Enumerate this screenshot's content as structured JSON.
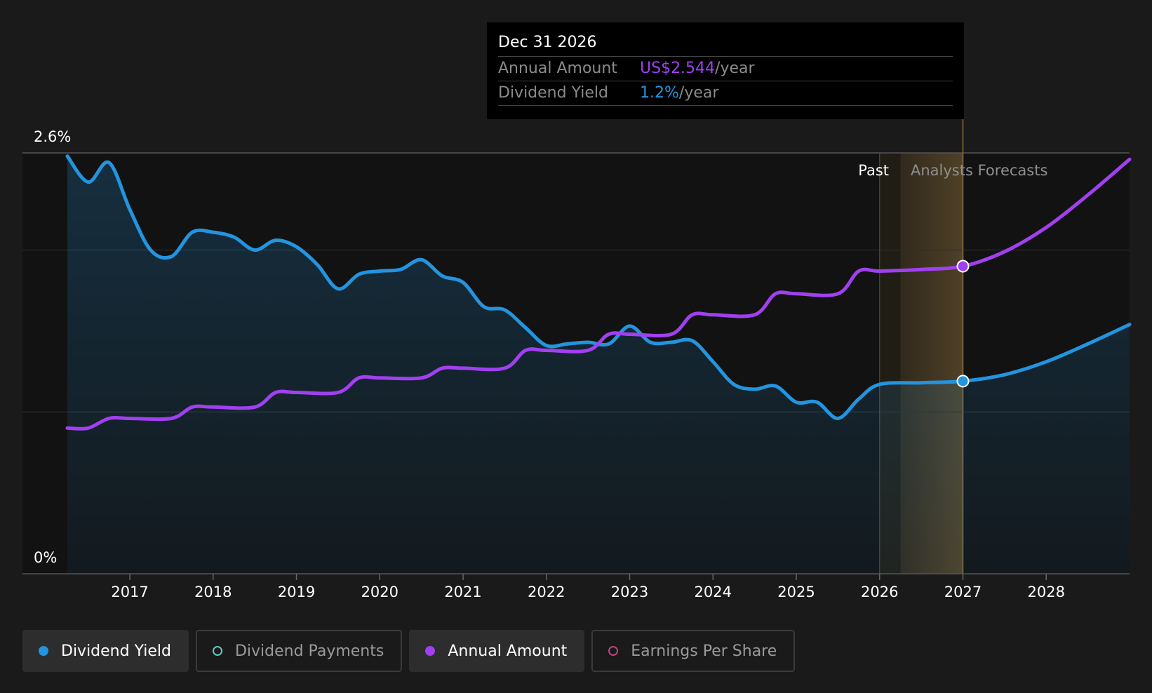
{
  "colors": {
    "yield": "#2394df",
    "annual": "#a040f0",
    "payments": "#5fc9bf",
    "eps": "#b9457e",
    "forecast_band": "#5a4a2a"
  },
  "tooltip": {
    "date": "Dec 31 2026",
    "rows": [
      {
        "label": "Annual Amount",
        "value": "US$2.544",
        "unit": "/year",
        "color": "#a040f0"
      },
      {
        "label": "Dividend Yield",
        "value": "1.2%",
        "unit": "/year",
        "color": "#2394df"
      }
    ]
  },
  "labels": {
    "past": "Past",
    "forecast": "Analysts Forecasts"
  },
  "legend": [
    {
      "label": "Dividend Yield",
      "active": true,
      "color": "#2394df",
      "icon": "filled-circle-icon"
    },
    {
      "label": "Dividend Payments",
      "active": false,
      "color": "#5fc9bf",
      "icon": "hollow-circle-icon"
    },
    {
      "label": "Annual Amount",
      "active": true,
      "color": "#a040f0",
      "icon": "filled-circle-icon"
    },
    {
      "label": "Earnings Per Share",
      "active": false,
      "color": "#b9457e",
      "icon": "hollow-circle-icon"
    }
  ],
  "chart_data": {
    "type": "line",
    "y_tick_labels": [
      "0%",
      "2.6%"
    ],
    "ylim": [
      0,
      2.6
    ],
    "xlim": [
      2016.25,
      2029.0
    ],
    "x_ticks": [
      "2017",
      "2018",
      "2019",
      "2020",
      "2021",
      "2022",
      "2023",
      "2024",
      "2025",
      "2026",
      "2027",
      "2028"
    ],
    "past_until": 2026.0,
    "forecast_start": 2026.25,
    "highlight_x": 2027.0,
    "legend_position": "bottom",
    "series": [
      {
        "name": "Dividend Yield",
        "area": true,
        "points": [
          [
            2016.25,
            2.58
          ],
          [
            2016.5,
            2.42
          ],
          [
            2016.75,
            2.54
          ],
          [
            2017.0,
            2.25
          ],
          [
            2017.25,
            2.0
          ],
          [
            2017.5,
            1.96
          ],
          [
            2017.75,
            2.11
          ],
          [
            2018.0,
            2.11
          ],
          [
            2018.25,
            2.08
          ],
          [
            2018.5,
            2.0
          ],
          [
            2018.75,
            2.06
          ],
          [
            2019.0,
            2.02
          ],
          [
            2019.25,
            1.91
          ],
          [
            2019.5,
            1.76
          ],
          [
            2019.75,
            1.85
          ],
          [
            2020.0,
            1.87
          ],
          [
            2020.25,
            1.88
          ],
          [
            2020.5,
            1.94
          ],
          [
            2020.75,
            1.84
          ],
          [
            2021.0,
            1.8
          ],
          [
            2021.25,
            1.65
          ],
          [
            2021.5,
            1.63
          ],
          [
            2021.75,
            1.52
          ],
          [
            2022.0,
            1.41
          ],
          [
            2022.25,
            1.42
          ],
          [
            2022.5,
            1.43
          ],
          [
            2022.75,
            1.42
          ],
          [
            2023.0,
            1.53
          ],
          [
            2023.25,
            1.43
          ],
          [
            2023.5,
            1.43
          ],
          [
            2023.75,
            1.44
          ],
          [
            2024.0,
            1.31
          ],
          [
            2024.25,
            1.17
          ],
          [
            2024.5,
            1.14
          ],
          [
            2024.75,
            1.16
          ],
          [
            2025.0,
            1.06
          ],
          [
            2025.25,
            1.06
          ],
          [
            2025.5,
            0.96
          ],
          [
            2025.75,
            1.08
          ],
          [
            2026.0,
            1.17
          ],
          [
            2026.5,
            1.18
          ],
          [
            2027.0,
            1.19
          ],
          [
            2027.5,
            1.23
          ],
          [
            2028.0,
            1.31
          ],
          [
            2028.5,
            1.42
          ],
          [
            2029.0,
            1.54
          ]
        ]
      },
      {
        "name": "Annual Amount",
        "area": false,
        "points": [
          [
            2016.25,
            0.9
          ],
          [
            2016.5,
            0.9
          ],
          [
            2016.75,
            0.96
          ],
          [
            2017.0,
            0.96
          ],
          [
            2017.5,
            0.96
          ],
          [
            2017.75,
            1.03
          ],
          [
            2018.0,
            1.03
          ],
          [
            2018.5,
            1.03
          ],
          [
            2018.75,
            1.12
          ],
          [
            2019.0,
            1.12
          ],
          [
            2019.5,
            1.12
          ],
          [
            2019.75,
            1.21
          ],
          [
            2020.0,
            1.21
          ],
          [
            2020.5,
            1.21
          ],
          [
            2020.75,
            1.27
          ],
          [
            2021.0,
            1.27
          ],
          [
            2021.5,
            1.27
          ],
          [
            2021.75,
            1.38
          ],
          [
            2022.0,
            1.38
          ],
          [
            2022.5,
            1.38
          ],
          [
            2022.75,
            1.48
          ],
          [
            2023.0,
            1.48
          ],
          [
            2023.5,
            1.48
          ],
          [
            2023.75,
            1.6
          ],
          [
            2024.0,
            1.6
          ],
          [
            2024.5,
            1.6
          ],
          [
            2024.75,
            1.73
          ],
          [
            2025.0,
            1.73
          ],
          [
            2025.5,
            1.73
          ],
          [
            2025.75,
            1.87
          ],
          [
            2026.0,
            1.87
          ],
          [
            2026.5,
            1.88
          ],
          [
            2027.0,
            1.9
          ],
          [
            2027.5,
            1.99
          ],
          [
            2028.0,
            2.14
          ],
          [
            2028.5,
            2.34
          ],
          [
            2029.0,
            2.56
          ]
        ],
        "highlight_value": 2.544
      }
    ]
  }
}
